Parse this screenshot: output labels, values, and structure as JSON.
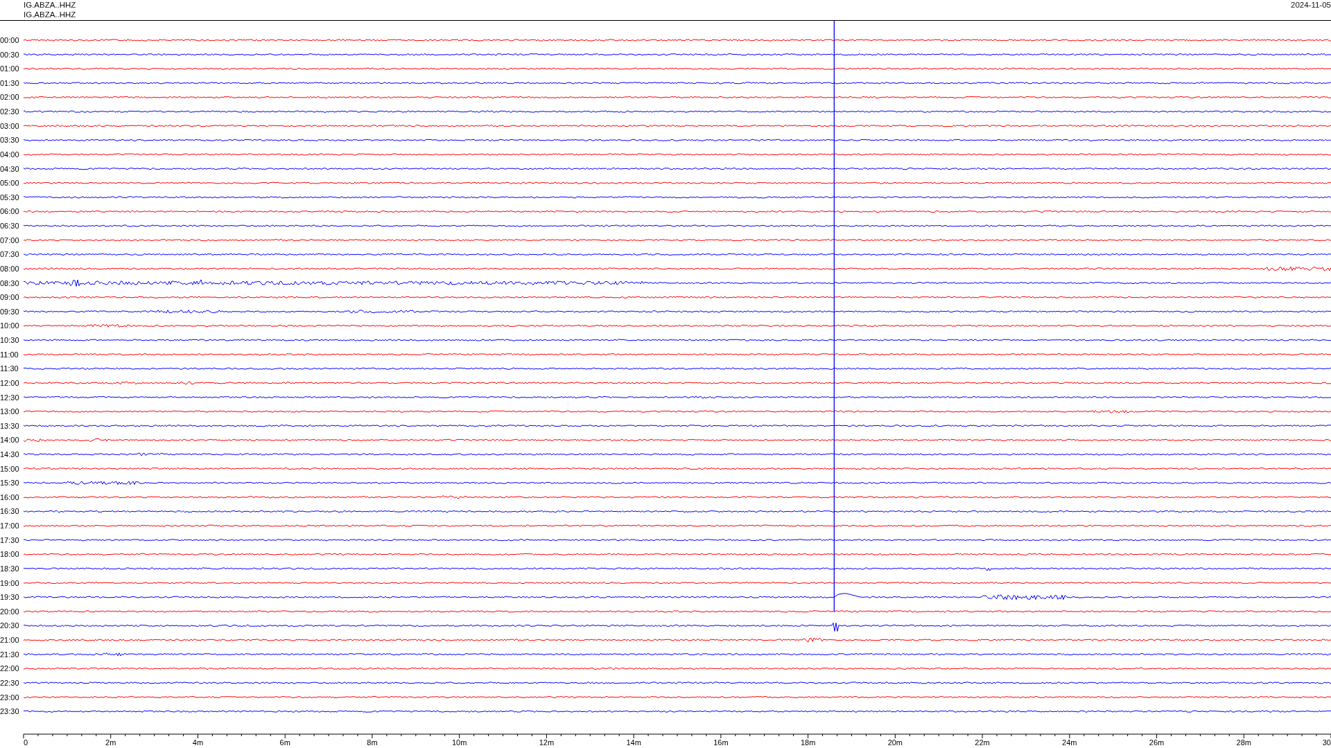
{
  "header": {
    "stations": [
      "IG.ABZA..HHZ",
      "IG.ABZA..HHZ"
    ],
    "date": "2024-11-05"
  },
  "helicorder": {
    "rows": [
      {
        "label": "00:00",
        "color": "#ff0000"
      },
      {
        "label": "00:30",
        "color": "#0000ff"
      },
      {
        "label": "01:00",
        "color": "#ff0000"
      },
      {
        "label": "01:30",
        "color": "#0000ff"
      },
      {
        "label": "02:00",
        "color": "#ff0000"
      },
      {
        "label": "02:30",
        "color": "#0000ff"
      },
      {
        "label": "03:00",
        "color": "#ff0000"
      },
      {
        "label": "03:30",
        "color": "#0000ff"
      },
      {
        "label": "04:00",
        "color": "#ff0000"
      },
      {
        "label": "04:30",
        "color": "#0000ff"
      },
      {
        "label": "05:00",
        "color": "#ff0000"
      },
      {
        "label": "05:30",
        "color": "#0000ff"
      },
      {
        "label": "06:00",
        "color": "#ff0000"
      },
      {
        "label": "06:30",
        "color": "#0000ff"
      },
      {
        "label": "07:00",
        "color": "#ff0000"
      },
      {
        "label": "07:30",
        "color": "#0000ff"
      },
      {
        "label": "08:00",
        "color": "#ff0000"
      },
      {
        "label": "08:30",
        "color": "#0000ff"
      },
      {
        "label": "09:00",
        "color": "#ff0000"
      },
      {
        "label": "09:30",
        "color": "#0000ff"
      },
      {
        "label": "10:00",
        "color": "#ff0000"
      },
      {
        "label": "10:30",
        "color": "#0000ff"
      },
      {
        "label": "11:00",
        "color": "#ff0000"
      },
      {
        "label": "11:30",
        "color": "#0000ff"
      },
      {
        "label": "12:00",
        "color": "#ff0000"
      },
      {
        "label": "12:30",
        "color": "#0000ff"
      },
      {
        "label": "13:00",
        "color": "#ff0000"
      },
      {
        "label": "13:30",
        "color": "#0000ff"
      },
      {
        "label": "14:00",
        "color": "#ff0000"
      },
      {
        "label": "14:30",
        "color": "#0000ff"
      },
      {
        "label": "15:00",
        "color": "#ff0000"
      },
      {
        "label": "15:30",
        "color": "#0000ff"
      },
      {
        "label": "16:00",
        "color": "#ff0000"
      },
      {
        "label": "16:30",
        "color": "#0000ff"
      },
      {
        "label": "17:00",
        "color": "#ff0000"
      },
      {
        "label": "17:30",
        "color": "#0000ff"
      },
      {
        "label": "18:00",
        "color": "#ff0000"
      },
      {
        "label": "18:30",
        "color": "#0000ff"
      },
      {
        "label": "19:00",
        "color": "#ff0000"
      },
      {
        "label": "19:30",
        "color": "#0000ff"
      },
      {
        "label": "20:00",
        "color": "#ff0000"
      },
      {
        "label": "20:30",
        "color": "#0000ff"
      },
      {
        "label": "21:00",
        "color": "#ff0000"
      },
      {
        "label": "21:30",
        "color": "#0000ff"
      },
      {
        "label": "22:00",
        "color": "#ff0000"
      },
      {
        "label": "22:30",
        "color": "#0000ff"
      },
      {
        "label": "23:00",
        "color": "#ff0000"
      },
      {
        "label": "23:30",
        "color": "#0000ff"
      }
    ],
    "x_axis_labels": [
      "0",
      "2m",
      "4m",
      "6m",
      "8m",
      "10m",
      "12m",
      "14m",
      "16m",
      "18m",
      "20m",
      "22m",
      "24m",
      "26m",
      "28m",
      "30"
    ]
  }
}
